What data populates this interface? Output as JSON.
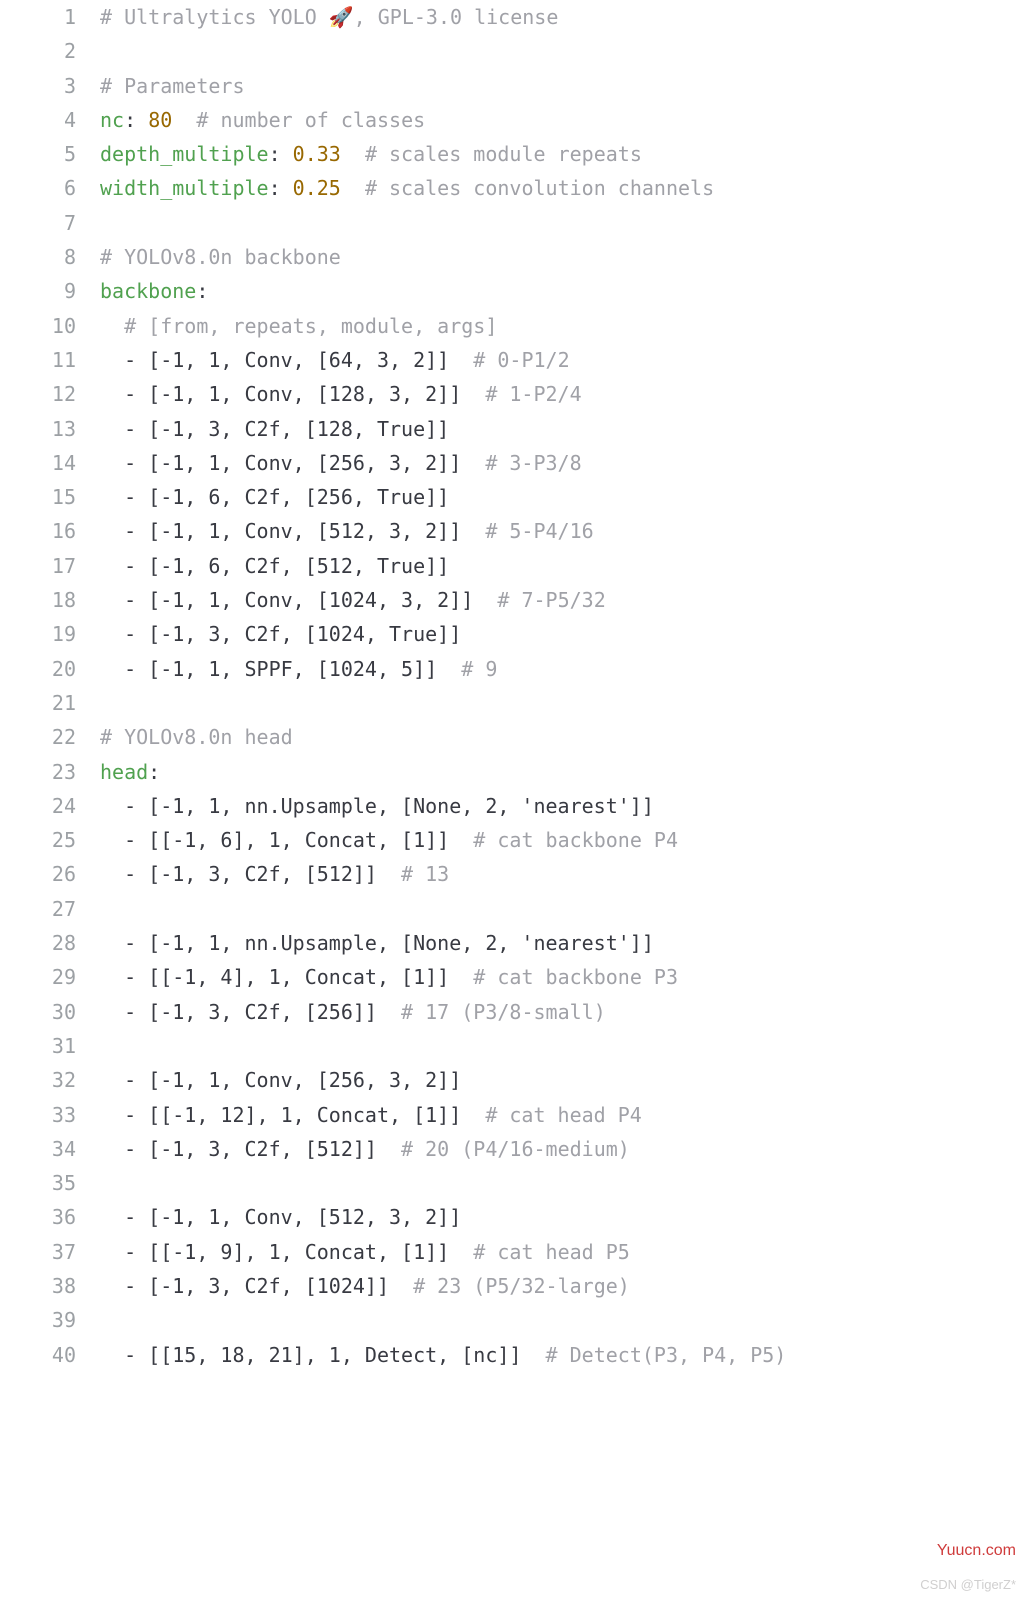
{
  "watermark": "Yuucn.com",
  "watermark2": "CSDN @TigerZ*",
  "lines": [
    {
      "n": 1,
      "segs": [
        {
          "c": "comment",
          "t": "# Ultralytics YOLO 🚀, GPL-3.0 license"
        }
      ]
    },
    {
      "n": 2,
      "segs": [
        {
          "c": "txt",
          "t": ""
        }
      ]
    },
    {
      "n": 3,
      "segs": [
        {
          "c": "comment",
          "t": "# Parameters"
        }
      ]
    },
    {
      "n": 4,
      "segs": [
        {
          "c": "key",
          "t": "nc"
        },
        {
          "c": "sep",
          "t": ": "
        },
        {
          "c": "num",
          "t": "80"
        },
        {
          "c": "txt",
          "t": "  "
        },
        {
          "c": "comment",
          "t": "# number of classes"
        }
      ]
    },
    {
      "n": 5,
      "segs": [
        {
          "c": "key",
          "t": "depth_multiple"
        },
        {
          "c": "sep",
          "t": ": "
        },
        {
          "c": "num",
          "t": "0.33"
        },
        {
          "c": "txt",
          "t": "  "
        },
        {
          "c": "comment",
          "t": "# scales module repeats"
        }
      ]
    },
    {
      "n": 6,
      "segs": [
        {
          "c": "key",
          "t": "width_multiple"
        },
        {
          "c": "sep",
          "t": ": "
        },
        {
          "c": "num",
          "t": "0.25"
        },
        {
          "c": "txt",
          "t": "  "
        },
        {
          "c": "comment",
          "t": "# scales convolution channels"
        }
      ]
    },
    {
      "n": 7,
      "segs": [
        {
          "c": "txt",
          "t": ""
        }
      ]
    },
    {
      "n": 8,
      "segs": [
        {
          "c": "comment",
          "t": "# YOLOv8.0n backbone"
        }
      ]
    },
    {
      "n": 9,
      "segs": [
        {
          "c": "key",
          "t": "backbone"
        },
        {
          "c": "sep",
          "t": ":"
        }
      ]
    },
    {
      "n": 10,
      "segs": [
        {
          "c": "txt",
          "t": "  "
        },
        {
          "c": "comment",
          "t": "# [from, repeats, module, args]"
        }
      ]
    },
    {
      "n": 11,
      "segs": [
        {
          "c": "txt",
          "t": "  - [-1, 1, Conv, [64, 3, 2]]  "
        },
        {
          "c": "comment",
          "t": "# 0-P1/2"
        }
      ]
    },
    {
      "n": 12,
      "segs": [
        {
          "c": "txt",
          "t": "  - [-1, 1, Conv, [128, 3, 2]]  "
        },
        {
          "c": "comment",
          "t": "# 1-P2/4"
        }
      ]
    },
    {
      "n": 13,
      "segs": [
        {
          "c": "txt",
          "t": "  - [-1, 3, C2f, [128, True]]"
        }
      ]
    },
    {
      "n": 14,
      "segs": [
        {
          "c": "txt",
          "t": "  - [-1, 1, Conv, [256, 3, 2]]  "
        },
        {
          "c": "comment",
          "t": "# 3-P3/8"
        }
      ]
    },
    {
      "n": 15,
      "segs": [
        {
          "c": "txt",
          "t": "  - [-1, 6, C2f, [256, True]]"
        }
      ]
    },
    {
      "n": 16,
      "segs": [
        {
          "c": "txt",
          "t": "  - [-1, 1, Conv, [512, 3, 2]]  "
        },
        {
          "c": "comment",
          "t": "# 5-P4/16"
        }
      ]
    },
    {
      "n": 17,
      "segs": [
        {
          "c": "txt",
          "t": "  - [-1, 6, C2f, [512, True]]"
        }
      ]
    },
    {
      "n": 18,
      "segs": [
        {
          "c": "txt",
          "t": "  - [-1, 1, Conv, [1024, 3, 2]]  "
        },
        {
          "c": "comment",
          "t": "# 7-P5/32"
        }
      ]
    },
    {
      "n": 19,
      "segs": [
        {
          "c": "txt",
          "t": "  - [-1, 3, C2f, [1024, True]]"
        }
      ]
    },
    {
      "n": 20,
      "segs": [
        {
          "c": "txt",
          "t": "  - [-1, 1, SPPF, [1024, 5]]  "
        },
        {
          "c": "comment",
          "t": "# 9"
        }
      ]
    },
    {
      "n": 21,
      "segs": [
        {
          "c": "txt",
          "t": ""
        }
      ]
    },
    {
      "n": 22,
      "segs": [
        {
          "c": "comment",
          "t": "# YOLOv8.0n head"
        }
      ]
    },
    {
      "n": 23,
      "segs": [
        {
          "c": "key",
          "t": "head"
        },
        {
          "c": "sep",
          "t": ":"
        }
      ]
    },
    {
      "n": 24,
      "segs": [
        {
          "c": "txt",
          "t": "  - [-1, 1, nn.Upsample, [None, 2, 'nearest']]"
        }
      ]
    },
    {
      "n": 25,
      "segs": [
        {
          "c": "txt",
          "t": "  - [[-1, 6], 1, Concat, [1]]  "
        },
        {
          "c": "comment",
          "t": "# cat backbone P4"
        }
      ]
    },
    {
      "n": 26,
      "segs": [
        {
          "c": "txt",
          "t": "  - [-1, 3, C2f, [512]]  "
        },
        {
          "c": "comment",
          "t": "# 13"
        }
      ]
    },
    {
      "n": 27,
      "segs": [
        {
          "c": "txt",
          "t": ""
        }
      ]
    },
    {
      "n": 28,
      "segs": [
        {
          "c": "txt",
          "t": "  - [-1, 1, nn.Upsample, [None, 2, 'nearest']]"
        }
      ]
    },
    {
      "n": 29,
      "segs": [
        {
          "c": "txt",
          "t": "  - [[-1, 4], 1, Concat, [1]]  "
        },
        {
          "c": "comment",
          "t": "# cat backbone P3"
        }
      ]
    },
    {
      "n": 30,
      "segs": [
        {
          "c": "txt",
          "t": "  - [-1, 3, C2f, [256]]  "
        },
        {
          "c": "comment",
          "t": "# 17 (P3/8-small)"
        }
      ]
    },
    {
      "n": 31,
      "segs": [
        {
          "c": "txt",
          "t": ""
        }
      ]
    },
    {
      "n": 32,
      "segs": [
        {
          "c": "txt",
          "t": "  - [-1, 1, Conv, [256, 3, 2]]"
        }
      ]
    },
    {
      "n": 33,
      "segs": [
        {
          "c": "txt",
          "t": "  - [[-1, 12], 1, Concat, [1]]  "
        },
        {
          "c": "comment",
          "t": "# cat head P4"
        }
      ]
    },
    {
      "n": 34,
      "segs": [
        {
          "c": "txt",
          "t": "  - [-1, 3, C2f, [512]]  "
        },
        {
          "c": "comment",
          "t": "# 20 (P4/16-medium)"
        }
      ]
    },
    {
      "n": 35,
      "segs": [
        {
          "c": "txt",
          "t": ""
        }
      ]
    },
    {
      "n": 36,
      "segs": [
        {
          "c": "txt",
          "t": "  - [-1, 1, Conv, [512, 3, 2]]"
        }
      ]
    },
    {
      "n": 37,
      "segs": [
        {
          "c": "txt",
          "t": "  - [[-1, 9], 1, Concat, [1]]  "
        },
        {
          "c": "comment",
          "t": "# cat head P5"
        }
      ]
    },
    {
      "n": 38,
      "segs": [
        {
          "c": "txt",
          "t": "  - [-1, 3, C2f, [1024]]  "
        },
        {
          "c": "comment",
          "t": "# 23 (P5/32-large)"
        }
      ]
    },
    {
      "n": 39,
      "segs": [
        {
          "c": "txt",
          "t": ""
        }
      ]
    },
    {
      "n": 40,
      "segs": [
        {
          "c": "txt",
          "t": "  - [[15, 18, 21], 1, Detect, [nc]]  "
        },
        {
          "c": "comment",
          "t": "# Detect(P3, P4, P5)"
        }
      ]
    }
  ]
}
